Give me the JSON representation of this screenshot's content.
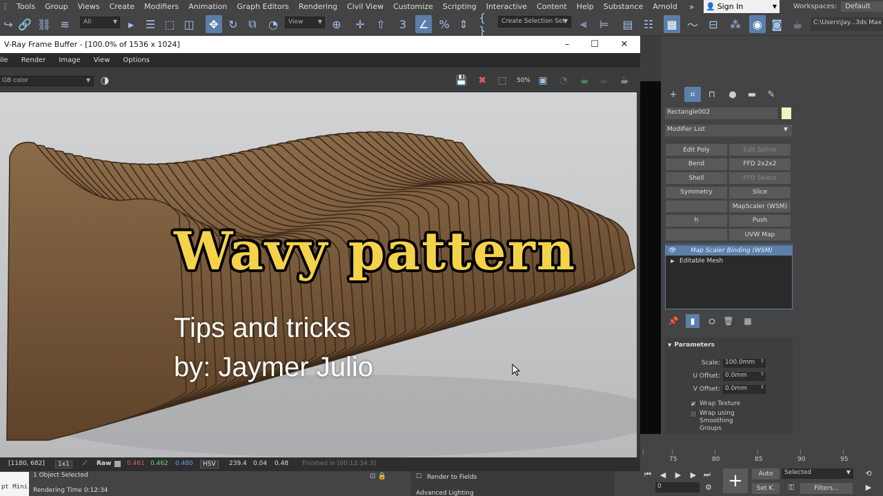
{
  "menu": {
    "items": [
      "Tools",
      "Group",
      "Views",
      "Create",
      "Modifiers",
      "Animation",
      "Graph Editors",
      "Rendering",
      "Civil View",
      "Customize",
      "Scripting",
      "Interactive",
      "Content",
      "Help",
      "Substance",
      "Arnold"
    ],
    "more": "»",
    "sign_in": "Sign In",
    "workspaces_label": "Workspaces:",
    "workspace_value": "Default"
  },
  "toolbar": {
    "filter_value": "All",
    "view_value": "View",
    "selection_set": "Create Selection Set",
    "path": "C:\\Users\\Jay...3ds Max 2"
  },
  "vfb": {
    "title": "V-Ray Frame Buffer - [100.0% of 1536 x 1024]",
    "menu": [
      "ile",
      "Render",
      "Image",
      "View",
      "Options"
    ],
    "channel": "GB color",
    "zoom_badge": "50%",
    "status": {
      "coords": "[1180, 682]",
      "ratio": "1x1",
      "mode": "Raw",
      "r": "0.461",
      "g": "0.462",
      "b": "0.480",
      "colorspace": "HSV",
      "h": "239.4",
      "s": "0.04",
      "v": "0.48",
      "finished": "Finished in [00:12:34.3]"
    }
  },
  "overlay": {
    "headline": "Wavy pattern",
    "line1": "Tips and tricks",
    "line2": "by: Jaymer Julio"
  },
  "colors": {
    "headline": "#f4d34a",
    "accent": "#5b7fa8",
    "r": "#e06060",
    "g": "#6ed36e",
    "b": "#6aa0e8",
    "wood": "#7a5a3c"
  },
  "command_panel": {
    "object_name": "Rectangle002",
    "modifier_list": "Modifier List",
    "buttons": [
      {
        "label": "Edit Poly",
        "dim": false
      },
      {
        "label": "Edit Spline",
        "dim": true
      },
      {
        "label": "Bend",
        "dim": false
      },
      {
        "label": "FFD 2x2x2",
        "dim": false
      },
      {
        "label": "Shell",
        "dim": false
      },
      {
        "label": "FFD Select",
        "dim": true
      },
      {
        "label": "Symmetry",
        "dim": false
      },
      {
        "label": "Slice",
        "dim": false
      },
      {
        "label": "",
        "dim": false
      },
      {
        "label": "MapScaler (WSM)",
        "dim": false
      },
      {
        "label": "h",
        "dim": false
      },
      {
        "label": "Push",
        "dim": false
      },
      {
        "label": "",
        "dim": false
      },
      {
        "label": "UVW Map",
        "dim": false
      }
    ],
    "stack": [
      "Map Scaler Binding (WSM)",
      "Editable Mesh"
    ],
    "parameters": {
      "header": "Parameters",
      "scale_label": "Scale:",
      "scale": "100.0mm",
      "u_label": "U Offset:",
      "u": "0.0mm",
      "v_label": "V Offset:",
      "v": "0.0mm",
      "wrap_texture": "Wrap Texture",
      "wrap_smoothing": "Wrap using Smoothing Groups"
    }
  },
  "bottom": {
    "maxscript": "pt Mini",
    "selected": "1 Object Selected",
    "render_time": "Rendering Time  0:12:34",
    "render_to_fields": "Render to Fields",
    "advanced_lighting": "Advanced Lighting",
    "ticks": [
      "75",
      "80",
      "85",
      "90",
      "95"
    ],
    "frame": "0",
    "auto": "Auto",
    "set_key": "Set K.",
    "selected_dd": "Selected",
    "filters": "Filters..."
  }
}
